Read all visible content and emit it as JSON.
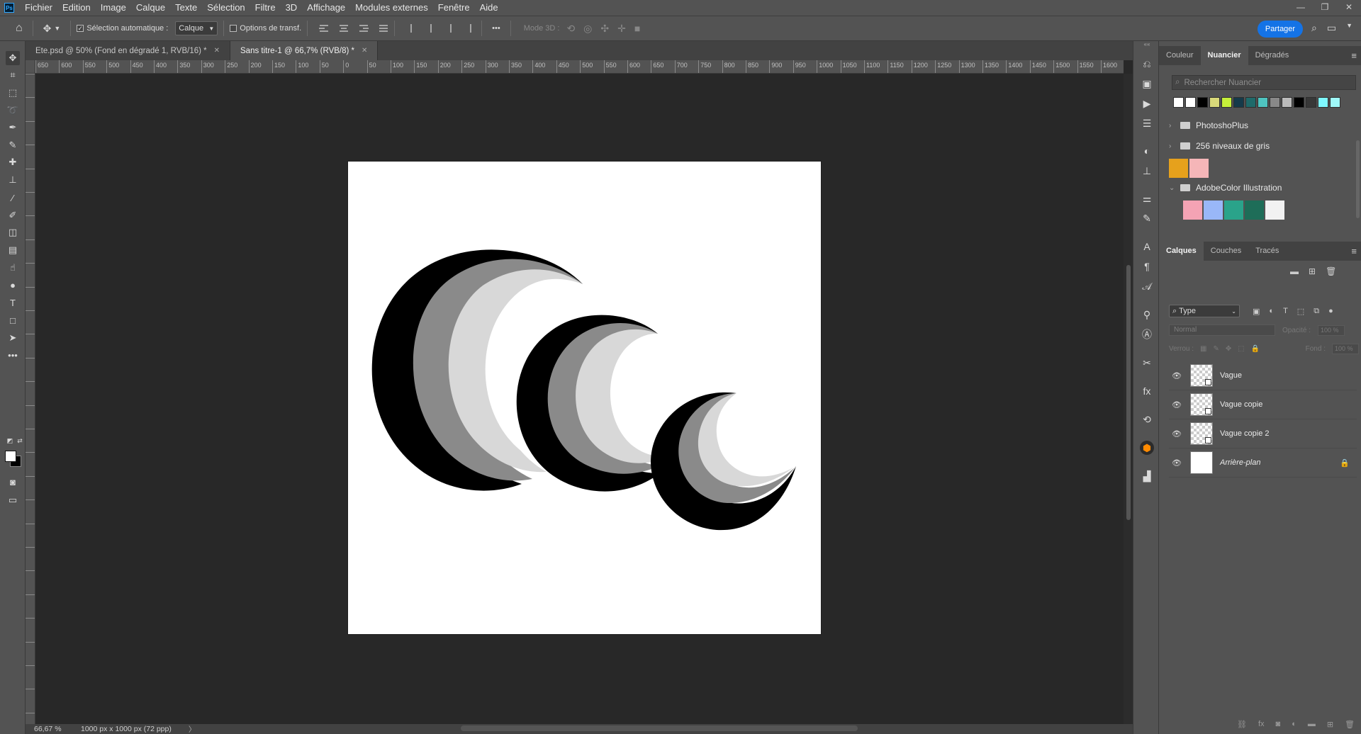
{
  "app": {
    "logo": "Ps"
  },
  "menu": [
    "Fichier",
    "Edition",
    "Image",
    "Calque",
    "Texte",
    "Sélection",
    "Filtre",
    "3D",
    "Affichage",
    "Modules externes",
    "Fenêtre",
    "Aide"
  ],
  "window_controls": {
    "minimize": "—",
    "restore": "❐",
    "close": "✕"
  },
  "options": {
    "auto_select_label": "Sélection automatique :",
    "auto_select_checked": true,
    "auto_select_value": "Calque",
    "transform_label": "Options de transf.",
    "more": "•••",
    "mode3d_label": "Mode 3D :",
    "share_label": "Partager"
  },
  "tabs": [
    {
      "label": "Ete.psd @ 50% (Fond en dégradé 1, RVB/16) *",
      "active": false
    },
    {
      "label": "Sans titre-1 @ 66,7% (RVB/8) *",
      "active": true
    }
  ],
  "ruler_labels": [
    "650",
    "600",
    "550",
    "500",
    "450",
    "400",
    "350",
    "300",
    "250",
    "200",
    "150",
    "100",
    "50",
    "0",
    "50",
    "100",
    "150",
    "200",
    "250",
    "300",
    "350",
    "400",
    "450",
    "500",
    "550",
    "600",
    "650",
    "700",
    "750",
    "800",
    "850",
    "900",
    "950",
    "1000",
    "1050",
    "1100",
    "1150",
    "1200",
    "1250",
    "1300",
    "1350",
    "1400",
    "1450",
    "1500",
    "1550",
    "1600"
  ],
  "status": {
    "zoom": "66,67 %",
    "info": "1000 px x 1000 px (72 ppp)",
    "arrow": "〉"
  },
  "colors": {
    "foreground": "#ffffff",
    "background": "#000000",
    "accent": "#1473e6"
  },
  "swatches_panel": {
    "tabs": [
      "Couleur",
      "Nuancier",
      "Dégradés"
    ],
    "active_tab": "Nuancier",
    "search_placeholder": "Rechercher Nuancier",
    "recent_swatches": [
      "#ffffff",
      "#ffffff",
      "#000000",
      "#d9d97a",
      "#c6f03a",
      "#153a4a",
      "#1f6a6a",
      "#4fc4c0",
      "#888888",
      "#bbbbbb",
      "#000000",
      "#383838",
      "#7ff8ff",
      "#9ff9f9"
    ],
    "folders": [
      {
        "name": "PhotoshoPlus",
        "expanded": false
      },
      {
        "name": "256 niveaux de gris",
        "expanded": false
      },
      {
        "name": "AdobeColor Illustration",
        "expanded": true
      }
    ],
    "loose_swatches": [
      "#e6a11c",
      "#f5b6b8"
    ],
    "illustration_swatches": [
      "#f4a3b4",
      "#99b7f8",
      "#2aa38a",
      "#1e6d58",
      "#f2f2f2"
    ]
  },
  "layers_panel": {
    "tabs": [
      "Calques",
      "Couches",
      "Tracés"
    ],
    "active_tab": "Calques",
    "filter_value": "Type",
    "blend_mode": "Normal",
    "opacity_label": "Opacité :",
    "opacity_value": "100 %",
    "lock_label": "Verrou :",
    "fill_label": "Fond :",
    "fill_value": "100 %",
    "layers": [
      {
        "name": "Vague",
        "visible": true,
        "locked": false,
        "italic": false
      },
      {
        "name": "Vague copie",
        "visible": true,
        "locked": false,
        "italic": false
      },
      {
        "name": "Vague copie 2",
        "visible": true,
        "locked": false,
        "italic": false
      },
      {
        "name": "Arrière-plan",
        "visible": true,
        "locked": true,
        "italic": true
      }
    ]
  }
}
